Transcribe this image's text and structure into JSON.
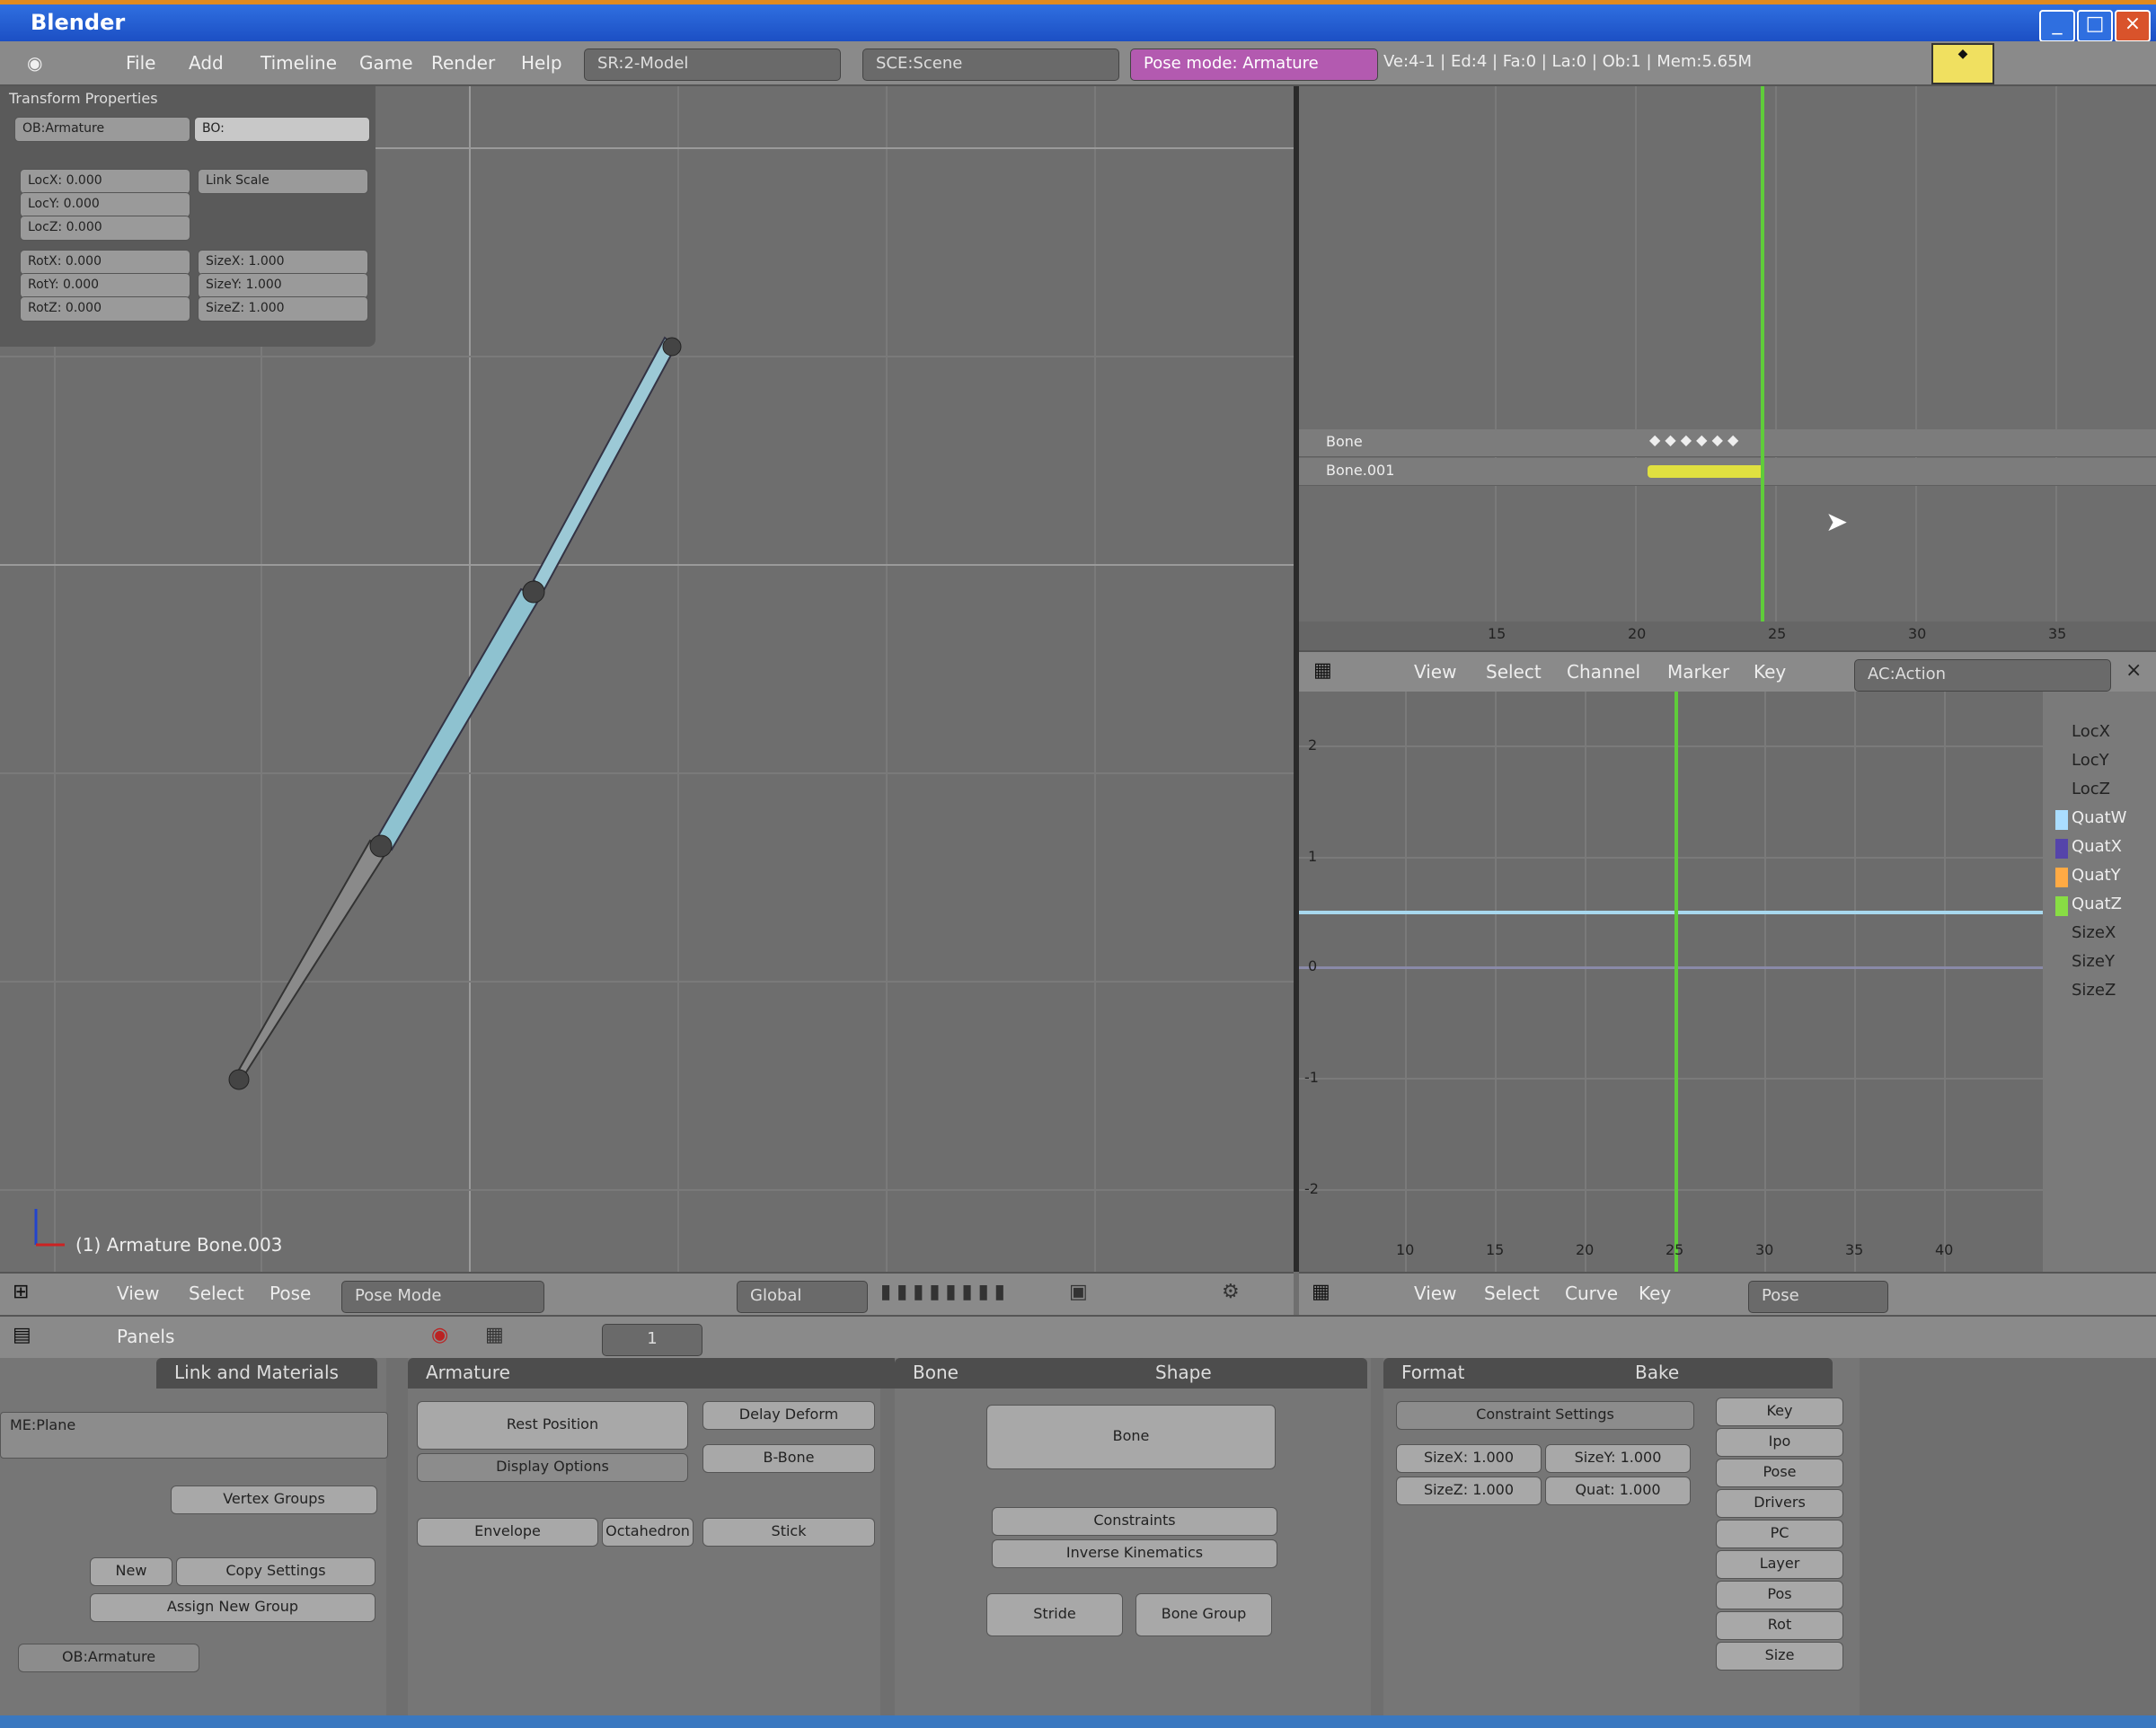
{
  "window": {
    "title": "Blender"
  },
  "infobar": {
    "menus": [
      "File",
      "Add",
      "Timeline",
      "Game",
      "Render",
      "Help"
    ],
    "screen_select": "SR:2-Model",
    "scene_select": "SCE:Scene",
    "pose_status": "Pose mode: Armature",
    "stats": "Ve:4-1 | Ed:4 | Fa:0 | La:0 | Ob:1 | Mem:5.65M"
  },
  "view3d": {
    "panel_title": "Transform Properties",
    "name_field": "OB:Armature",
    "bone_field": "BO:",
    "pos_btns": [
      "LocX: 0.000",
      "LocY: 0.000",
      "LocZ: 0.000"
    ],
    "rot_btns": [
      "RotX: 0.000",
      "RotY: 0.000",
      "RotZ: 0.000"
    ],
    "scale_btns": [
      "SizeX: 1.000",
      "SizeY: 1.000",
      "SizeZ: 1.000"
    ],
    "link_btn": "Link Scale",
    "object_label": "(1) Armature Bone.003",
    "header_menus": [
      "View",
      "Select",
      "Pose"
    ],
    "mode": "Pose Mode",
    "pivot": "Global"
  },
  "action": {
    "channels": [
      "Bone",
      "Bone.001"
    ],
    "frame_ticks": [
      "15",
      "20",
      "25",
      "30",
      "35"
    ],
    "header_menus": [
      "View",
      "Select",
      "Channel",
      "Marker",
      "Key"
    ],
    "action_name": "AC:Action"
  },
  "ipo": {
    "channels": [
      "LocX",
      "LocY",
      "LocZ",
      "QuatW",
      "QuatX",
      "QuatY",
      "QuatZ",
      "SizeX",
      "SizeY",
      "SizeZ"
    ],
    "channel_colors": [
      "#aaddff",
      "#5544aa",
      "#ffaa44",
      "#88dd44"
    ],
    "y_ticks": [
      "2",
      "1",
      "0",
      "-1",
      "-2"
    ],
    "x_ticks": [
      "10",
      "15",
      "20",
      "25",
      "30",
      "35",
      "40"
    ],
    "header_menus": [
      "View",
      "Select",
      "Curve",
      "Key"
    ],
    "ipo_type": "Pose"
  },
  "buttons": {
    "header_label": "Panels",
    "frame_field": "1",
    "link_panel": {
      "tab": "Link and Materials",
      "me_field": "ME:Plane",
      "ob_field": "OB:Armature",
      "vg_label": "Vertex Groups",
      "new_btn": "New",
      "copy_btn": "Copy Settings",
      "set_btn": "Assign New Group"
    },
    "armature_panel": {
      "tab": "Armature",
      "rest_pos": "Rest Position",
      "display": "Display Options",
      "btns": [
        "Delay Deform",
        "B-Bone",
        "Envelope",
        "Octahedron",
        "Stick"
      ]
    },
    "shading_panel": {
      "tabs": [
        "Bone",
        "Shape"
      ],
      "bone_name": "Bone",
      "btns": [
        "Constraints",
        "Inverse Kinematics",
        "Stride",
        "Bone Group"
      ]
    },
    "format_panel": {
      "tabs": [
        "Format",
        "Bake"
      ],
      "preset": "Constraint Settings",
      "fields": [
        "SizeX: 1.000",
        "SizeY: 1.000",
        "SizeZ: 1.000",
        "Quat: 1.000"
      ],
      "right_btns": [
        "Key",
        "Ipo",
        "Pose",
        "Drivers",
        "PC",
        "Layer",
        "Pos",
        "Rot",
        "Size"
      ]
    }
  }
}
